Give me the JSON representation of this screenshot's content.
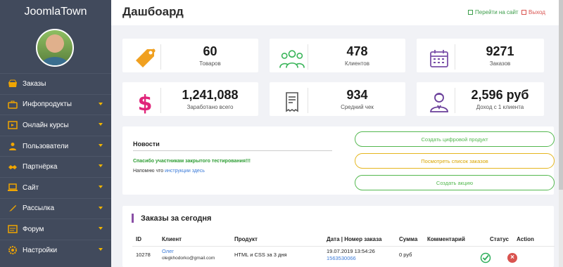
{
  "brand": "JoomlaTown",
  "sidebar": {
    "items": [
      {
        "label": "Заказы",
        "icon": "shop-icon",
        "has_submenu": false
      },
      {
        "label": "Инфопродукты",
        "icon": "briefcase-icon",
        "has_submenu": true
      },
      {
        "label": "Онлайн курсы",
        "icon": "video-icon",
        "has_submenu": true
      },
      {
        "label": "Пользователи",
        "icon": "users-icon",
        "has_submenu": true
      },
      {
        "label": "Партнёрка",
        "icon": "handshake-icon",
        "has_submenu": true
      },
      {
        "label": "Сайт",
        "icon": "laptop-icon",
        "has_submenu": true
      },
      {
        "label": "Рассылка",
        "icon": "rocket-icon",
        "has_submenu": true
      },
      {
        "label": "Форум",
        "icon": "forum-icon",
        "has_submenu": true
      },
      {
        "label": "Настройки",
        "icon": "gear-icon",
        "has_submenu": true
      }
    ]
  },
  "header": {
    "title": "Дашбоард",
    "site_link": "Перейти на сайт",
    "exit_link": "Выход"
  },
  "stats": [
    {
      "value": "60",
      "label": "Товаров",
      "icon": "tag-icon",
      "color": "#f0a020"
    },
    {
      "value": "478",
      "label": "Клиентов",
      "icon": "group-icon",
      "color": "#3ab55a"
    },
    {
      "value": "9271",
      "label": "Заказов",
      "icon": "calendar-icon",
      "color": "#7a4fa8"
    },
    {
      "value": "1,241,088",
      "label": "Заработано всего",
      "icon": "dollar-icon",
      "color": "#e0247a"
    },
    {
      "value": "934",
      "label": "Средний чек",
      "icon": "receipt-icon",
      "color": "#555555"
    },
    {
      "value": "2,596 руб",
      "label": "Доход с 1 клиента",
      "icon": "client-icon",
      "color": "#6a3f9a"
    }
  ],
  "news": {
    "title": "Новости",
    "headline": "Спасибо участникам закрытого тестирования!!!",
    "text_before": "Напомню что ",
    "link": "инструкции здесь"
  },
  "actions": {
    "create_product": "Создать цифровой продукт",
    "view_orders": "Посмотреть список заказов",
    "create_promo": "Создать акцию"
  },
  "orders": {
    "title": "Заказы за сегодня",
    "columns": [
      "ID",
      "Клиент",
      "Продукт",
      "Дата | Номер заказа",
      "Сумма",
      "Комментарий",
      "Статус",
      "Action"
    ],
    "rows": [
      {
        "id": "10278",
        "client_name": "Олег",
        "client_email": "olegkhodorko@gmail.com",
        "product": "HTML и CSS за 3 дня",
        "date": "19.07.2019 13:54:26",
        "order_number": "1563530066",
        "sum": "0 руб",
        "comment": "",
        "status": "ok"
      }
    ]
  }
}
